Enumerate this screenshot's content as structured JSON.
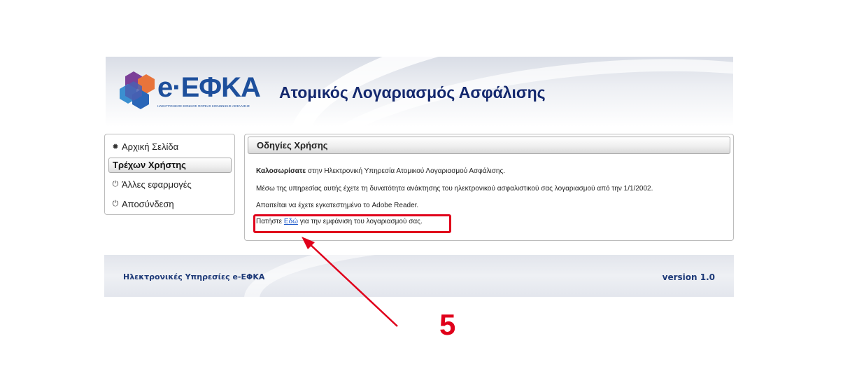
{
  "header": {
    "logo_text": "e·ΕΦΚΑ",
    "logo_subtitle": "ΗΛΕΚΤΡΟΝΙΚΟΣ ΕΘΝΙΚΟΣ ΦΟΡΕΑΣ ΚΟΙΝΩΝΙΚΗΣ ΑΣΦΑΛΙΣΗΣ",
    "title": "Ατομικός Λογαριασμός Ασφάλισης"
  },
  "sidebar": {
    "home": {
      "label": "Αρχική Σελίδα",
      "icon": "gear-icon"
    },
    "current_user": "Τρέχων Χρήστης",
    "other_apps": {
      "label": "Άλλες εφαρμογές",
      "icon": "power-icon"
    },
    "logout": {
      "label": "Αποσύνδεση",
      "icon": "power-icon"
    }
  },
  "main": {
    "heading": "Οδηγίες Χρήσης",
    "welcome_bold": "Καλοσωρίσατε",
    "welcome_rest": " στην Ηλεκτρονική Υπηρεσία Ατομικού Λογαριασμού Ασφάλισης.",
    "line2": "Μέσω της υπηρεσίας αυτής έχετε τη δυνατότητα ανάκτησης του ηλεκτρονικού ασφαλιστικού σας λογαριασμού από την 1/1/2002.",
    "line3": "Απαιτείται να έχετε εγκατεστημένο το Adobe Reader.",
    "line4_pre": "Πατήστε ",
    "line4_link": "Εδώ",
    "line4_post": " για την εμφάνιση του λογαριασμού σας."
  },
  "footer": {
    "left": "Ηλεκτρονικές Υπηρεσίες e-ΕΦΚΑ",
    "right": "version 1.0"
  },
  "annotation": {
    "step_number": "5",
    "color": "#e0001b"
  }
}
